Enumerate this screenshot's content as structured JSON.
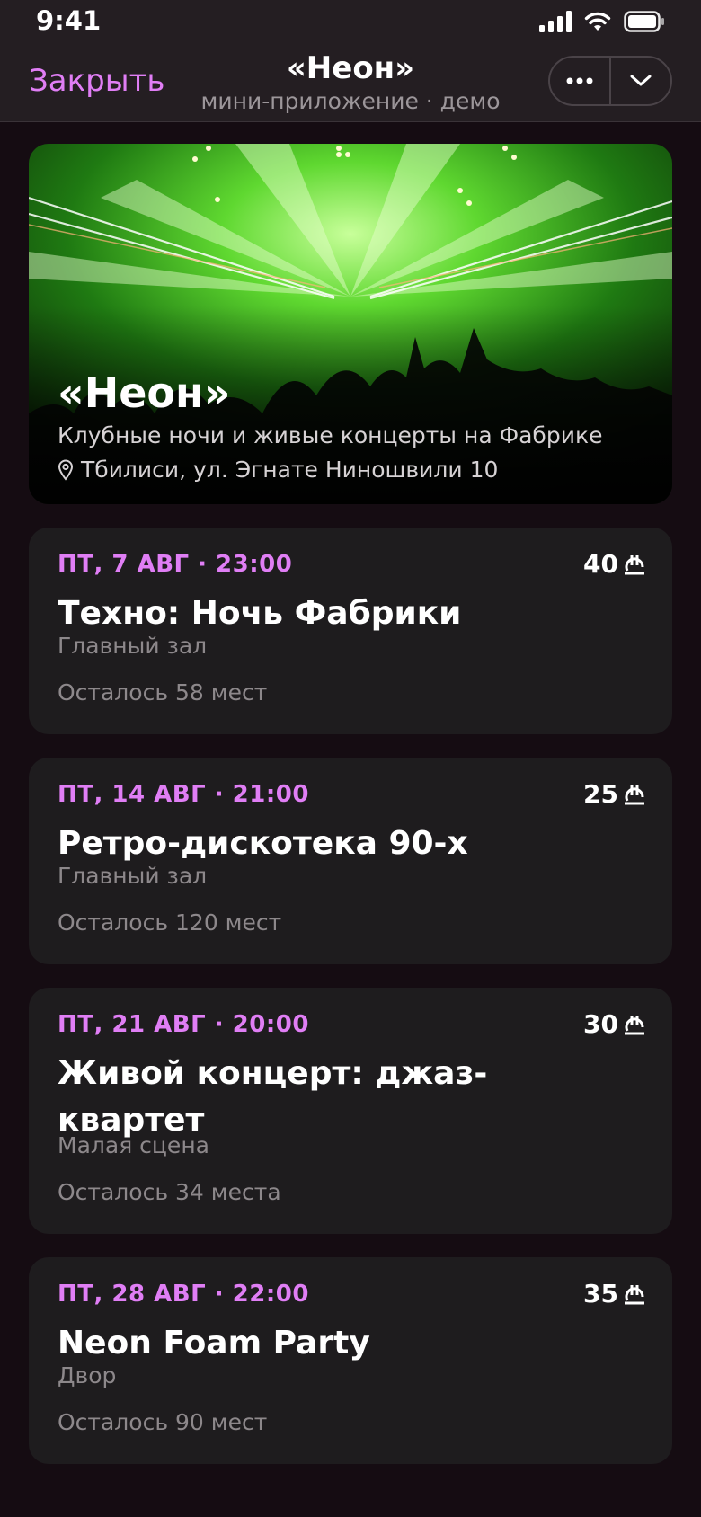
{
  "status_bar": {
    "time": "9:41"
  },
  "header": {
    "close_label": "Закрыть",
    "title": "«Неон»",
    "subtitle": "мини-приложение · демо"
  },
  "hero": {
    "title": "«Неон»",
    "description": "Клубные ночи и живые концерты на Фабрике",
    "location": "Тбилиси, ул. Эгнате Ниношвили 10"
  },
  "colors": {
    "accent": "#e07ef5",
    "background": "#150c12",
    "card": "#1e1c1e",
    "header": "#241e22"
  },
  "icons": [
    "more-icon",
    "chevron-down-icon",
    "location-pin-icon",
    "lari-icon",
    "signal-icon",
    "wifi-icon",
    "battery-icon"
  ],
  "events": [
    {
      "date": "ПТ, 7 АВГ · 23:00",
      "price": "40",
      "title": "Техно: Ночь Фабрики",
      "venue": "Главный зал",
      "seats": "Осталось 58 мест"
    },
    {
      "date": "ПТ, 14 АВГ · 21:00",
      "price": "25",
      "title": "Ретро-дискотека 90-х",
      "venue": "Главный зал",
      "seats": "Осталось 120 мест"
    },
    {
      "date": "ПТ, 21 АВГ · 20:00",
      "price": "30",
      "title": "Живой концерт: джаз-квартет",
      "venue": "Малая сцена",
      "seats": "Осталось 34 места"
    },
    {
      "date": "ПТ, 28 АВГ · 22:00",
      "price": "35",
      "title": "Neon Foam Party",
      "venue": "Двор",
      "seats": "Осталось 90 мест"
    }
  ]
}
